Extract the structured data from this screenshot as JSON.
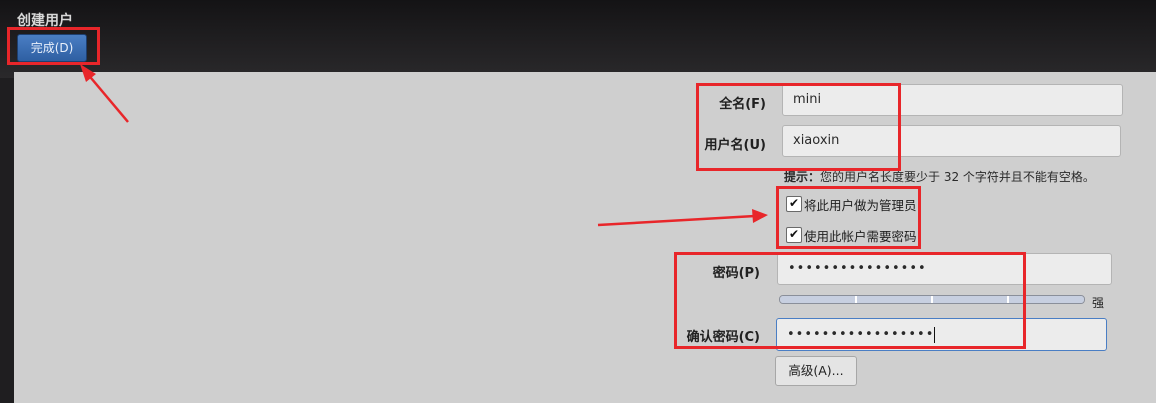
{
  "window": {
    "title": "创建用户"
  },
  "toolbar": {
    "done_label": "完成(D)"
  },
  "form": {
    "fullname_label": "全名(F)",
    "fullname_value": "mini",
    "username_label": "用户名(U)",
    "username_value": "xiaoxin",
    "hint_prefix": "提示：",
    "hint_text": "您的用户名长度要少于 32 个字符并且不能有空格。",
    "admin_checkbox_label": "将此用户做为管理员",
    "admin_checked": true,
    "require_password_label": "使用此帐户需要密码",
    "require_password_checked": true,
    "password_label": "密码(P)",
    "password_value": "••••••••••••••••",
    "password_strength": 1.0,
    "password_strength_label": "强",
    "confirm_label": "确认密码(C)",
    "confirm_value": "•••••••••••••••••",
    "advanced_label": "高级(A)..."
  },
  "colors": {
    "accent": "#3b6fb6",
    "annotation": "#e8262a"
  }
}
